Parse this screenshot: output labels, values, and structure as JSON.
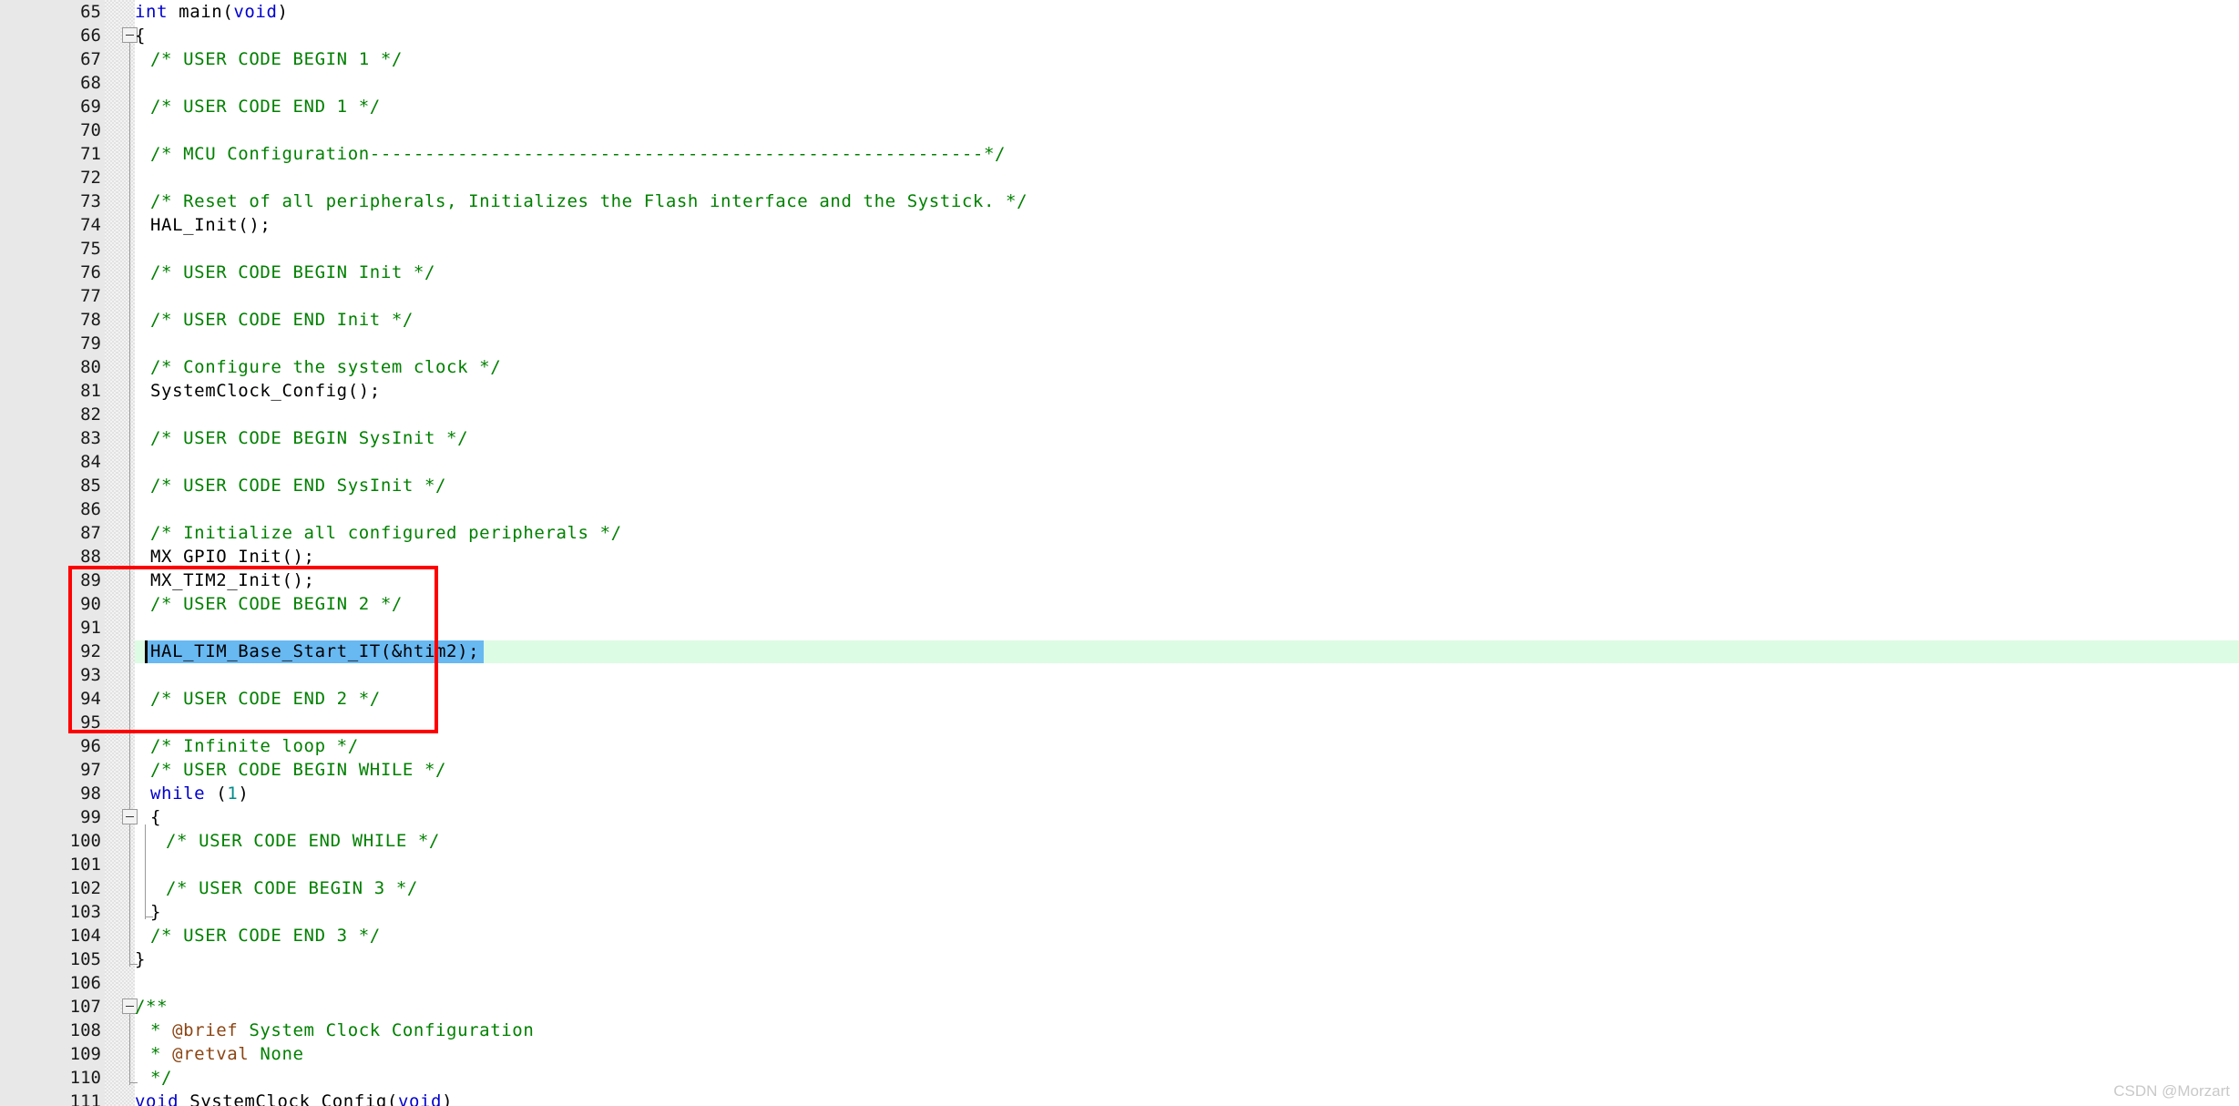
{
  "editor": {
    "language": "c",
    "first_visible_line": 65,
    "last_visible_line": 111,
    "line_height_px": 26,
    "colors": {
      "background": "#ffffff",
      "gutter_background": "#e8e8e8",
      "marker_strip": "#f3f3f3",
      "keyword": "#0000d0",
      "comment": "#008000",
      "doc_tag": "#8b4513",
      "number": "#008b8b",
      "plain_text": "#000000",
      "current_line_highlight": "#ddfce4",
      "selection": "#68b8f2",
      "annotation_box": "#ff0000",
      "line_number_text": "#1a1a1a",
      "fold_guide": "#9a9a9a"
    },
    "current_line": 92,
    "selected_text": "HAL_TIM_Base_Start_IT(&htim2);"
  },
  "annotation": {
    "type": "red-rectangle",
    "covers_lines": "89-95",
    "color": "#ff0000"
  },
  "watermark": {
    "text": "CSDN @Morzart"
  },
  "lines": [
    {
      "n": 65,
      "indent": 0,
      "tokens": [
        {
          "t": "kw",
          "s": "int"
        },
        {
          "t": "plain",
          "s": " main("
        },
        {
          "t": "kw",
          "s": "void"
        },
        {
          "t": "plain",
          "s": ")"
        }
      ]
    },
    {
      "n": 66,
      "indent": 0,
      "tokens": [
        {
          "t": "plain",
          "s": "{"
        }
      ]
    },
    {
      "n": 67,
      "indent": 1,
      "tokens": [
        {
          "t": "com",
          "s": "/* USER CODE BEGIN 1 */"
        }
      ]
    },
    {
      "n": 68,
      "indent": 0,
      "tokens": []
    },
    {
      "n": 69,
      "indent": 1,
      "tokens": [
        {
          "t": "com",
          "s": "/* USER CODE END 1 */"
        }
      ]
    },
    {
      "n": 70,
      "indent": 0,
      "tokens": []
    },
    {
      "n": 71,
      "indent": 1,
      "tokens": [
        {
          "t": "com",
          "s": "/* MCU Configuration--------------------------------------------------------*/"
        }
      ]
    },
    {
      "n": 72,
      "indent": 0,
      "tokens": []
    },
    {
      "n": 73,
      "indent": 1,
      "tokens": [
        {
          "t": "com",
          "s": "/* Reset of all peripherals, Initializes the Flash interface and the Systick. */"
        }
      ]
    },
    {
      "n": 74,
      "indent": 1,
      "tokens": [
        {
          "t": "plain",
          "s": "HAL_Init();"
        }
      ]
    },
    {
      "n": 75,
      "indent": 0,
      "tokens": []
    },
    {
      "n": 76,
      "indent": 1,
      "tokens": [
        {
          "t": "com",
          "s": "/* USER CODE BEGIN Init */"
        }
      ]
    },
    {
      "n": 77,
      "indent": 0,
      "tokens": []
    },
    {
      "n": 78,
      "indent": 1,
      "tokens": [
        {
          "t": "com",
          "s": "/* USER CODE END Init */"
        }
      ]
    },
    {
      "n": 79,
      "indent": 0,
      "tokens": []
    },
    {
      "n": 80,
      "indent": 1,
      "tokens": [
        {
          "t": "com",
          "s": "/* Configure the system clock */"
        }
      ]
    },
    {
      "n": 81,
      "indent": 1,
      "tokens": [
        {
          "t": "plain",
          "s": "SystemClock_Config();"
        }
      ]
    },
    {
      "n": 82,
      "indent": 0,
      "tokens": []
    },
    {
      "n": 83,
      "indent": 1,
      "tokens": [
        {
          "t": "com",
          "s": "/* USER CODE BEGIN SysInit */"
        }
      ]
    },
    {
      "n": 84,
      "indent": 0,
      "tokens": []
    },
    {
      "n": 85,
      "indent": 1,
      "tokens": [
        {
          "t": "com",
          "s": "/* USER CODE END SysInit */"
        }
      ]
    },
    {
      "n": 86,
      "indent": 0,
      "tokens": []
    },
    {
      "n": 87,
      "indent": 1,
      "tokens": [
        {
          "t": "com",
          "s": "/* Initialize all configured peripherals */"
        }
      ]
    },
    {
      "n": 88,
      "indent": 1,
      "tokens": [
        {
          "t": "plain",
          "s": "MX_GPIO_Init();"
        }
      ]
    },
    {
      "n": 89,
      "indent": 1,
      "tokens": [
        {
          "t": "plain",
          "s": "MX_TIM2_Init();"
        }
      ]
    },
    {
      "n": 90,
      "indent": 1,
      "tokens": [
        {
          "t": "com",
          "s": "/* USER CODE BEGIN 2 */"
        }
      ]
    },
    {
      "n": 91,
      "indent": 0,
      "tokens": []
    },
    {
      "n": 92,
      "indent": 1,
      "tokens": [
        {
          "t": "plain",
          "s": "HAL_TIM_Base_Start_IT(&htim2);"
        }
      ]
    },
    {
      "n": 93,
      "indent": 0,
      "tokens": []
    },
    {
      "n": 94,
      "indent": 1,
      "tokens": [
        {
          "t": "com",
          "s": "/* USER CODE END 2 */"
        }
      ]
    },
    {
      "n": 95,
      "indent": 0,
      "tokens": []
    },
    {
      "n": 96,
      "indent": 1,
      "tokens": [
        {
          "t": "com",
          "s": "/* Infinite loop */"
        }
      ]
    },
    {
      "n": 97,
      "indent": 1,
      "tokens": [
        {
          "t": "com",
          "s": "/* USER CODE BEGIN WHILE */"
        }
      ]
    },
    {
      "n": 98,
      "indent": 1,
      "tokens": [
        {
          "t": "kw",
          "s": "while"
        },
        {
          "t": "plain",
          "s": " ("
        },
        {
          "t": "num",
          "s": "1"
        },
        {
          "t": "plain",
          "s": ")"
        }
      ]
    },
    {
      "n": 99,
      "indent": 1,
      "tokens": [
        {
          "t": "plain",
          "s": "{"
        }
      ]
    },
    {
      "n": 100,
      "indent": 2,
      "tokens": [
        {
          "t": "com",
          "s": "/* USER CODE END WHILE */"
        }
      ]
    },
    {
      "n": 101,
      "indent": 0,
      "tokens": []
    },
    {
      "n": 102,
      "indent": 2,
      "tokens": [
        {
          "t": "com",
          "s": "/* USER CODE BEGIN 3 */"
        }
      ]
    },
    {
      "n": 103,
      "indent": 1,
      "tokens": [
        {
          "t": "plain",
          "s": "}"
        }
      ]
    },
    {
      "n": 104,
      "indent": 1,
      "tokens": [
        {
          "t": "com",
          "s": "/* USER CODE END 3 */"
        }
      ]
    },
    {
      "n": 105,
      "indent": 0,
      "tokens": [
        {
          "t": "plain",
          "s": "}"
        }
      ]
    },
    {
      "n": 106,
      "indent": 0,
      "tokens": []
    },
    {
      "n": 107,
      "indent": 0,
      "tokens": [
        {
          "t": "doc",
          "s": "/**"
        }
      ]
    },
    {
      "n": 108,
      "indent": 1,
      "tokens": [
        {
          "t": "doc",
          "s": "* "
        },
        {
          "t": "doctag",
          "s": "@brief"
        },
        {
          "t": "doc",
          "s": " System Clock Configuration"
        }
      ]
    },
    {
      "n": 109,
      "indent": 1,
      "tokens": [
        {
          "t": "doc",
          "s": "* "
        },
        {
          "t": "doctag",
          "s": "@retval"
        },
        {
          "t": "doc",
          "s": " None"
        }
      ]
    },
    {
      "n": 110,
      "indent": 1,
      "tokens": [
        {
          "t": "doc",
          "s": "*/"
        }
      ]
    },
    {
      "n": 111,
      "indent": 0,
      "tokens": [
        {
          "t": "kw",
          "s": "void"
        },
        {
          "t": "plain",
          "s": " SystemClock_Config("
        },
        {
          "t": "kw",
          "s": "void"
        },
        {
          "t": "plain",
          "s": ")"
        }
      ]
    }
  ]
}
